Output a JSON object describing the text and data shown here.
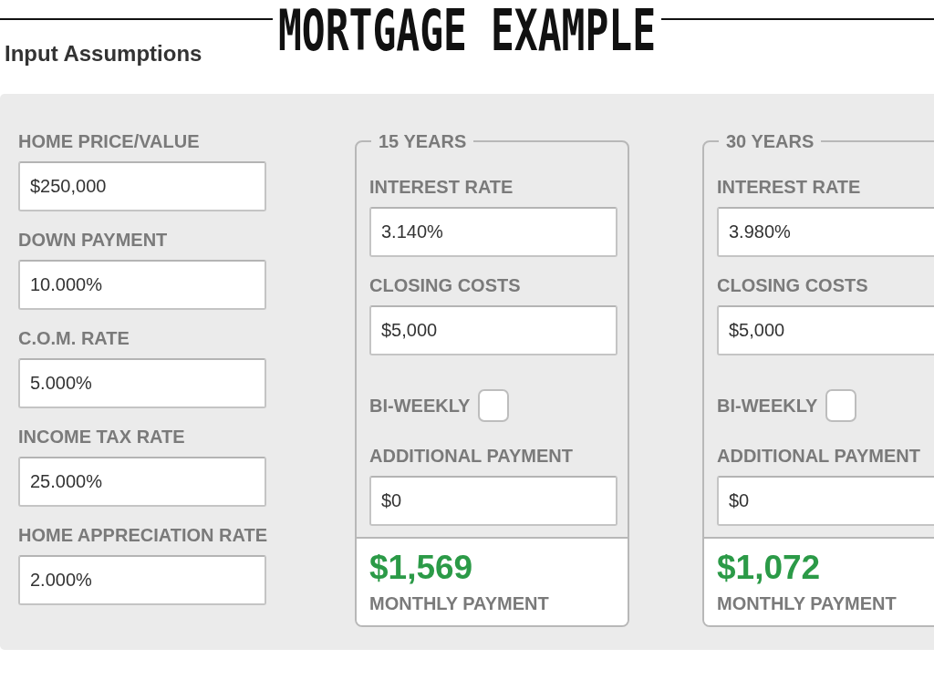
{
  "slide_title": "MORTGAGE EXAMPLE",
  "section_title": "Input Assumptions",
  "inputs": [
    {
      "label": "HOME PRICE/VALUE",
      "value": "$250,000"
    },
    {
      "label": "DOWN PAYMENT",
      "value": "10.000%"
    },
    {
      "label": "C.O.M. RATE",
      "value": "5.000%"
    },
    {
      "label": "INCOME TAX RATE",
      "value": "25.000%"
    },
    {
      "label": "HOME APPRECIATION RATE",
      "value": "2.000%"
    }
  ],
  "loan_options": [
    {
      "title": "15 YEARS",
      "fields": [
        {
          "kind": "input",
          "label": "INTEREST RATE",
          "value": "3.140%"
        },
        {
          "kind": "input",
          "label": "CLOSING COSTS",
          "value": "$5,000"
        },
        {
          "kind": "checkbox",
          "label": "BI-WEEKLY",
          "checked": false
        },
        {
          "kind": "input",
          "label": "ADDITIONAL PAYMENT",
          "value": "$0"
        }
      ],
      "monthly_payment": {
        "amount": "$1,569",
        "label": "MONTHLY PAYMENT"
      }
    },
    {
      "title": "30 YEARS",
      "fields": [
        {
          "kind": "input",
          "label": "INTEREST RATE",
          "value": "3.980%"
        },
        {
          "kind": "input",
          "label": "CLOSING COSTS",
          "value": "$5,000"
        },
        {
          "kind": "checkbox",
          "label": "BI-WEEKLY",
          "checked": false
        },
        {
          "kind": "input",
          "label": "ADDITIONAL PAYMENT",
          "value": "$0"
        }
      ],
      "monthly_payment": {
        "amount": "$1,072",
        "label": "MONTHLY PAYMENT"
      }
    }
  ]
}
